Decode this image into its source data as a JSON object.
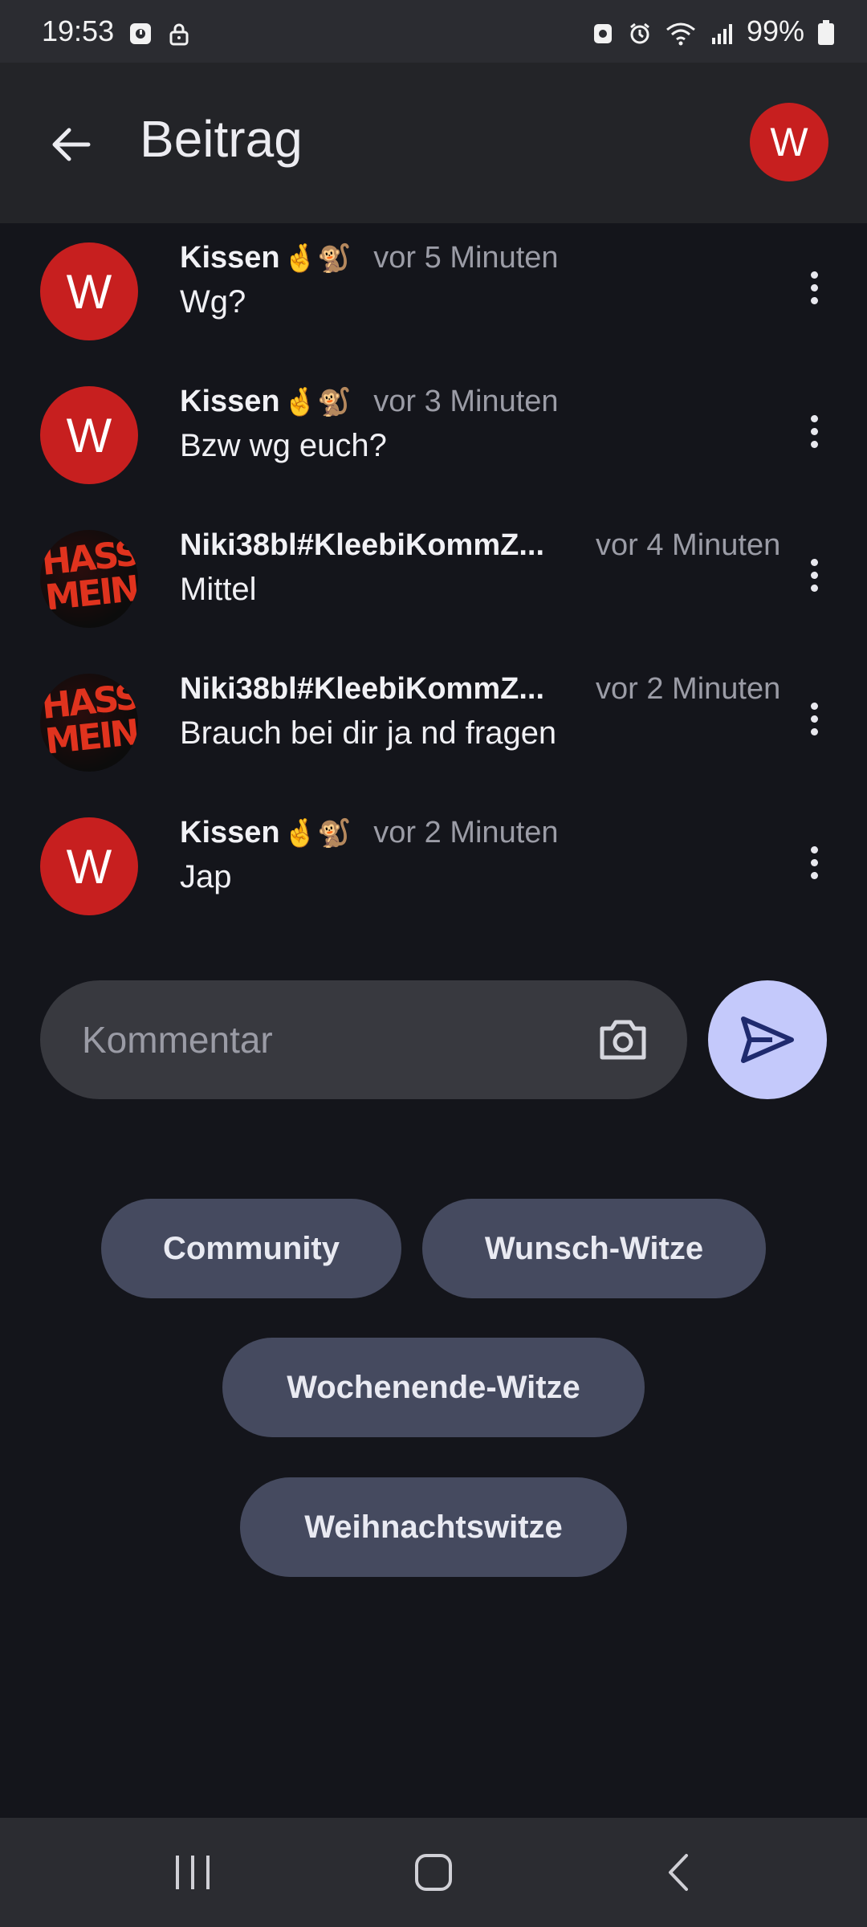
{
  "status_bar": {
    "time": "19:53",
    "battery": "99%",
    "left_icons": [
      "media-icon",
      "lock-icon"
    ],
    "right_icons": [
      "screenshot-icon",
      "alarm-icon",
      "wifi-icon",
      "signal-icon",
      "battery-icon"
    ]
  },
  "header": {
    "title": "Beitrag",
    "avatar_letter": "W"
  },
  "comments": [
    {
      "author": "Kissen",
      "emoji": "🤞🐒",
      "time": "vor 5 Minuten",
      "text": "Wg?",
      "avatar": "W"
    },
    {
      "author": "Kissen",
      "emoji": "🤞🐒",
      "time": "vor 3 Minuten",
      "text": "Bzw wg euch?",
      "avatar": "W"
    },
    {
      "author": "Niki38bl#KleebiKommZ...",
      "emoji": "",
      "time": "vor 4 Minuten",
      "text": "Mittel",
      "avatar": "HASS MEIN"
    },
    {
      "author": "Niki38bl#KleebiKommZ...",
      "emoji": "",
      "time": "vor 2 Minuten",
      "text": "Brauch bei dir ja nd fragen",
      "avatar": "HASS MEIN"
    },
    {
      "author": "Kissen",
      "emoji": "🤞🐒",
      "time": "vor 2 Minuten",
      "text": "Jap",
      "avatar": "W"
    }
  ],
  "comment_input": {
    "placeholder": "Kommentar",
    "value": ""
  },
  "categories": [
    "Community",
    "Wunsch-Witze",
    "Wochenende-Witze",
    "Weihnachtswitze"
  ],
  "colors": {
    "avatar_red": "#c71f1f",
    "send_button": "#c4c9fb",
    "chip_bg": "#454a5f",
    "background": "#14151b"
  }
}
